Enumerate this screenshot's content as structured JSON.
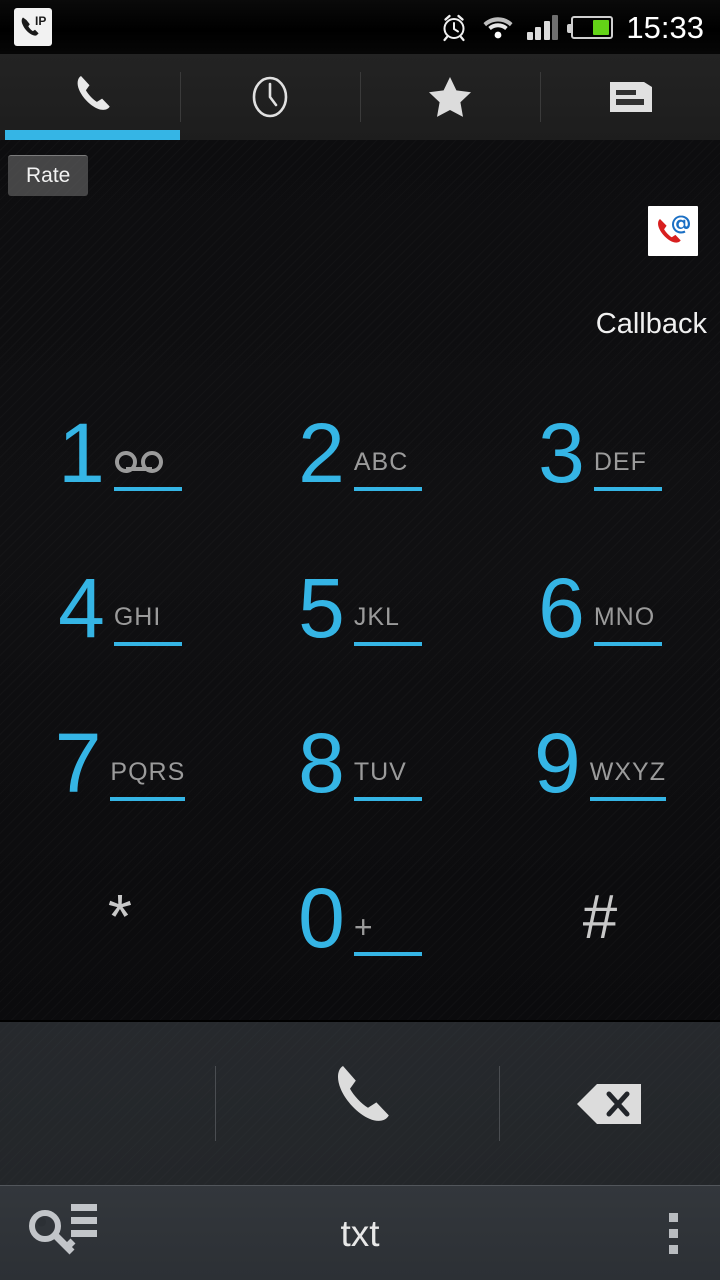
{
  "statusbar": {
    "time": "15:33",
    "icons": {
      "ip_call": "ip-phone-icon",
      "ip_text": "IP",
      "alarm": "alarm-clock-icon",
      "wifi": "wifi-icon",
      "signal": "cellular-signal-icon",
      "battery": "battery-icon"
    },
    "signal_bars_filled": 3,
    "signal_bars_total": 4,
    "battery_percent": 44,
    "battery_color": "#63d317"
  },
  "tabs": [
    {
      "name": "tab-dialer",
      "icon": "phone-handset-icon",
      "active": true
    },
    {
      "name": "tab-recents",
      "icon": "clock-icon",
      "active": false
    },
    {
      "name": "tab-favorites",
      "icon": "star-icon",
      "active": false
    },
    {
      "name": "tab-contacts",
      "icon": "contacts-card-icon",
      "active": false
    }
  ],
  "overlay": {
    "rate_button": "Rate",
    "callback_label": "Callback",
    "callback_icon": "callback-phone-at-icon"
  },
  "keypad": {
    "keys": [
      {
        "digit": "1",
        "letters": "",
        "icon": "voicemail-icon",
        "underline": true,
        "symbol": false
      },
      {
        "digit": "2",
        "letters": "ABC",
        "icon": "",
        "underline": true,
        "symbol": false
      },
      {
        "digit": "3",
        "letters": "DEF",
        "icon": "",
        "underline": true,
        "symbol": false
      },
      {
        "digit": "4",
        "letters": "GHI",
        "icon": "",
        "underline": true,
        "symbol": false
      },
      {
        "digit": "5",
        "letters": "JKL",
        "icon": "",
        "underline": true,
        "symbol": false
      },
      {
        "digit": "6",
        "letters": "MNO",
        "icon": "",
        "underline": true,
        "symbol": false
      },
      {
        "digit": "7",
        "letters": "PQRS",
        "icon": "",
        "underline": true,
        "symbol": false
      },
      {
        "digit": "8",
        "letters": "TUV",
        "icon": "",
        "underline": true,
        "symbol": false
      },
      {
        "digit": "9",
        "letters": "WXYZ",
        "icon": "",
        "underline": true,
        "symbol": false
      },
      {
        "digit": "*",
        "letters": "",
        "icon": "",
        "underline": false,
        "symbol": true
      },
      {
        "digit": "0",
        "letters": "+",
        "icon": "",
        "underline": true,
        "symbol": false
      },
      {
        "digit": "#",
        "letters": "",
        "icon": "",
        "underline": false,
        "symbol": true
      }
    ]
  },
  "actionbar": {
    "call_icon": "call-phone-icon",
    "backspace_icon": "backspace-icon"
  },
  "navbar": {
    "keypad_icon": "key-list-icon",
    "label": "txt",
    "overflow_icon": "overflow-menu-icon"
  },
  "colors": {
    "accent_blue": "#35b5e5",
    "letters_gray": "#9b9b9b",
    "symbol_gray": "#c8c8c8",
    "background": "#0d0d0f",
    "actionbar": "#26292d",
    "navbar": "#33373c"
  }
}
